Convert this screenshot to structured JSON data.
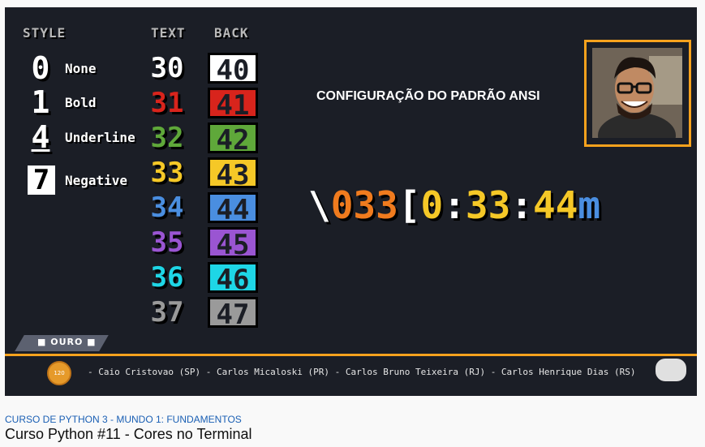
{
  "headers": {
    "style": "STYLE",
    "text": "TEXT",
    "back": "BACK"
  },
  "styles": [
    {
      "num": "0",
      "label": "None"
    },
    {
      "num": "1",
      "label": "Bold"
    },
    {
      "num": "4",
      "label": "Underline"
    },
    {
      "num": "7",
      "label": "Negative"
    }
  ],
  "text_codes": [
    "30",
    "31",
    "32",
    "33",
    "34",
    "35",
    "36",
    "37"
  ],
  "back_codes": [
    "40",
    "41",
    "42",
    "43",
    "44",
    "45",
    "46",
    "47"
  ],
  "colors": [
    "#ffffff",
    "#d8241c",
    "#5fa83a",
    "#f5c827",
    "#4a8ee0",
    "#9a55d2",
    "#1ed6e6",
    "#9a9a9a"
  ],
  "title": "CONFIGURAÇÃO DO PADRÃO ANSI",
  "escape": {
    "parts": [
      {
        "text": "\\",
        "color": "#ffffff"
      },
      {
        "text": "033",
        "color": "#f07b1e"
      },
      {
        "text": "[",
        "color": "#ffffff"
      },
      {
        "text": "0",
        "color": "#f5c827"
      },
      {
        "text": ":",
        "color": "#ffffff"
      },
      {
        "text": "33",
        "color": "#f5c827"
      },
      {
        "text": ":",
        "color": "#ffffff"
      },
      {
        "text": "44",
        "color": "#f5c827"
      },
      {
        "text": "m",
        "color": "#4a8ee0"
      }
    ]
  },
  "badge": "OURO",
  "medal_number": "120",
  "supporters": "- Caio Cristovao (SP) - Carlos Micaloski (PR) - Carlos Bruno Teixeira (RJ) - Carlos Henrique Dias (RS)",
  "course": "CURSO DE PYTHON 3 - MUNDO 1: FUNDAMENTOS",
  "video_title": "Curso Python #11 - Cores no Terminal"
}
